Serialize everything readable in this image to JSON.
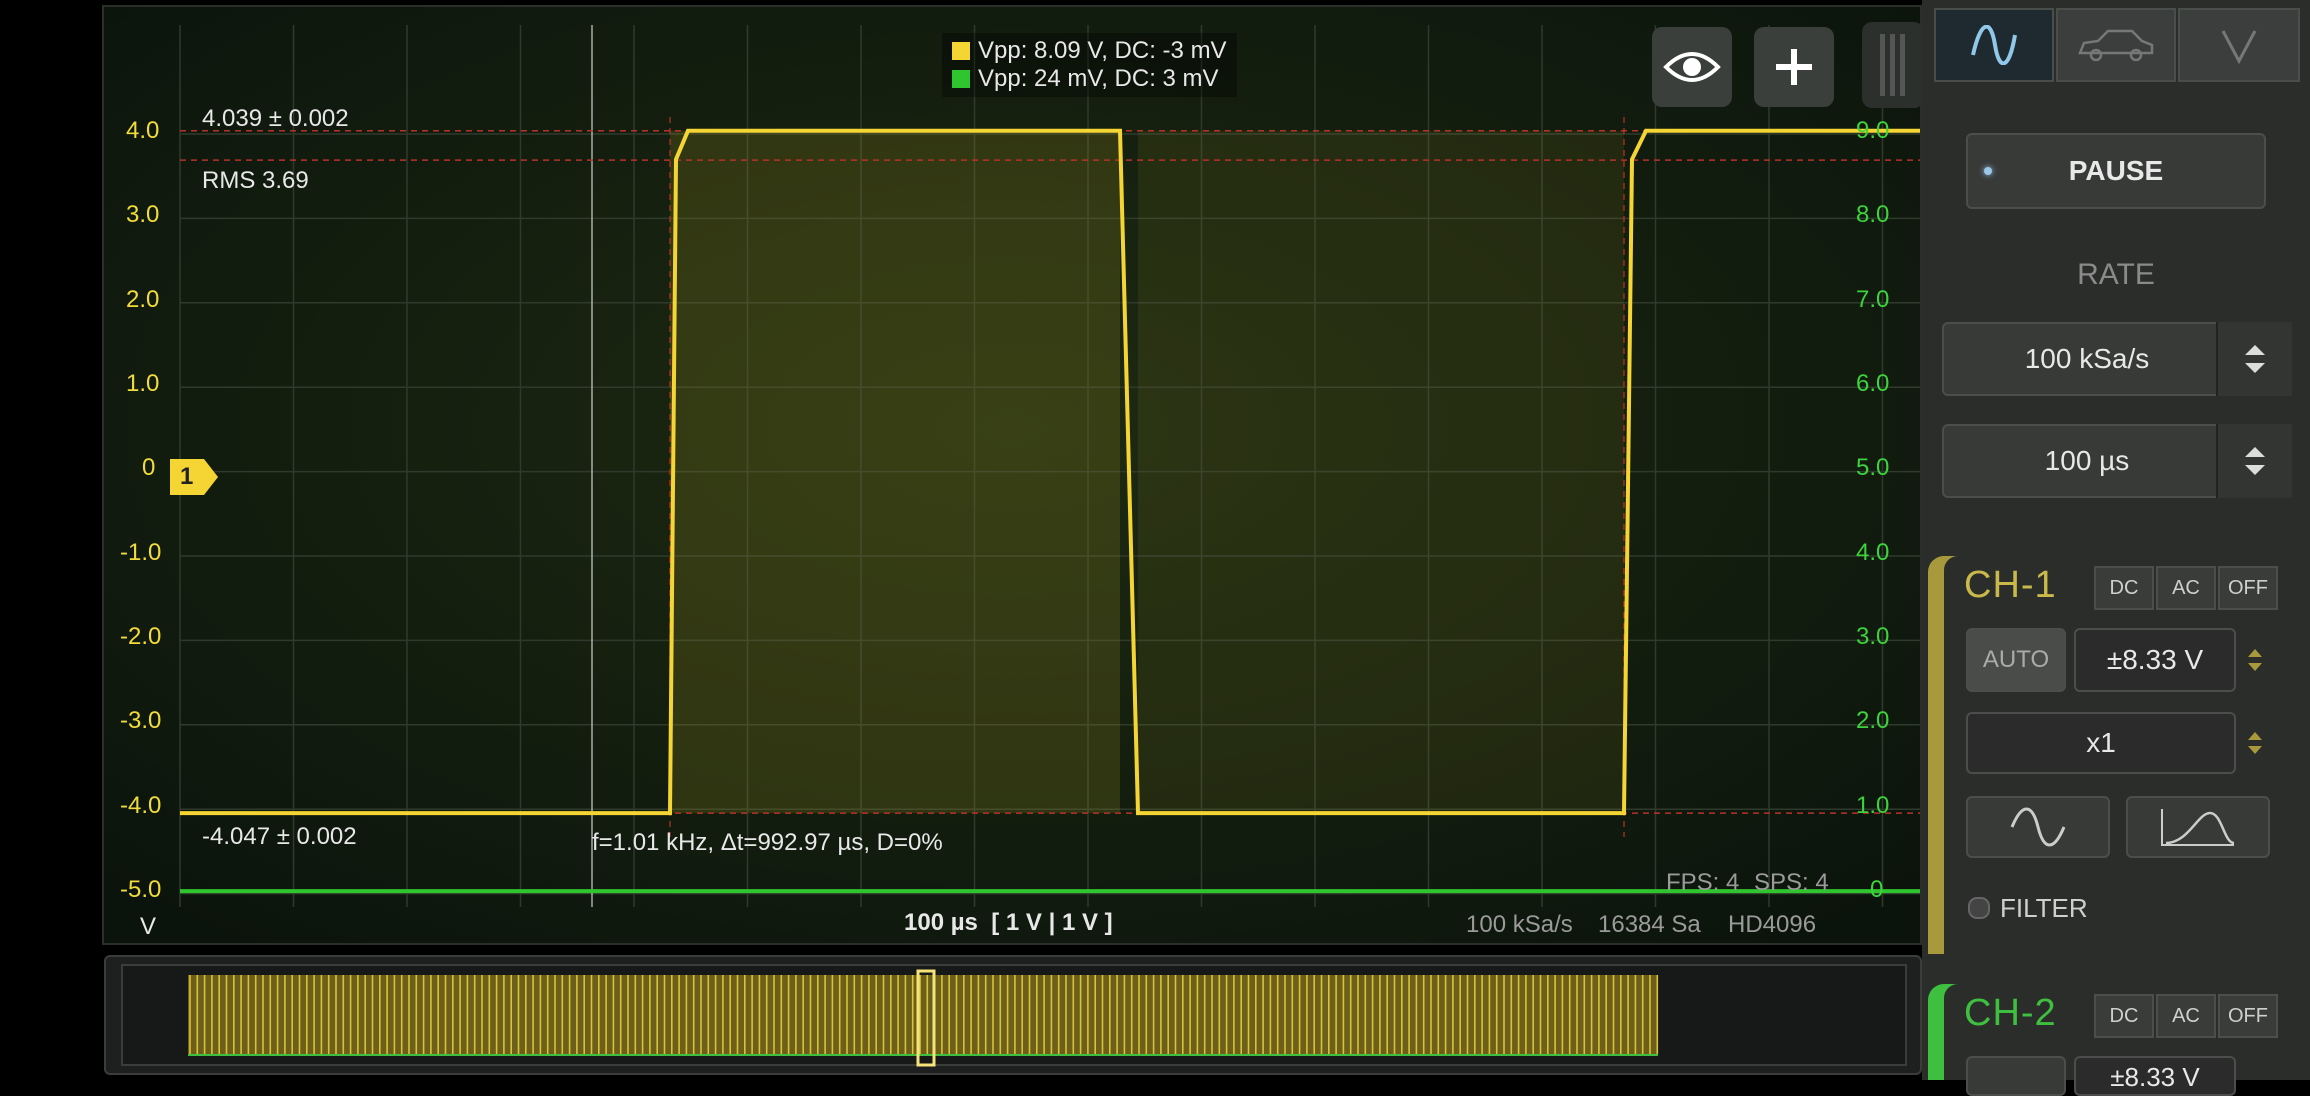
{
  "legend": {
    "ch1": {
      "text": "Vpp: 8.09 V, DC: -3 mV",
      "color": "#f5d533"
    },
    "ch2": {
      "text": "Vpp: 24 mV, DC: 3 mV",
      "color": "#2fc52f"
    }
  },
  "measurements": {
    "high": "4.039 ± 0.002",
    "rms": "RMS 3.69",
    "low": "-4.047 ± 0.002",
    "freq": "f=1.01 kHz, Δt=992.97 µs, D=0%"
  },
  "left_axis": {
    "ticks": [
      "4.0",
      "3.0",
      "2.0",
      "1.0",
      "0",
      "-1.0",
      "-2.0",
      "-3.0",
      "-4.0",
      "-5.0"
    ],
    "unit": "V",
    "marker": "1"
  },
  "right_axis": {
    "ticks": [
      "9.0",
      "8.0",
      "7.0",
      "6.0",
      "5.0",
      "4.0",
      "3.0",
      "2.0",
      "1.0",
      "0"
    ]
  },
  "bottom": {
    "timebase": "100 µs  [ 1 V | 1 V ]",
    "rate": "100 kSa/s",
    "samples": "16384 Sa",
    "hd": "HD4096",
    "fps": "FPS: 4",
    "sps": "SPS: 4"
  },
  "icons": {
    "eye": "eye-icon",
    "plus": "plus-icon",
    "wave": "sine-wave-icon",
    "car": "car-icon",
    "volt": "volt-v-icon"
  },
  "controls": {
    "pause": "PAUSE",
    "rate_label": "RATE",
    "sample_rate": "100 kSa/s",
    "time_div": "100 µs"
  },
  "ch1": {
    "title": "CH-1",
    "coupling": [
      "DC",
      "AC",
      "OFF"
    ],
    "auto": "AUTO",
    "range": "±8.33 V",
    "probe": "x1",
    "filter": "FILTER",
    "color": "#c9b94a"
  },
  "ch2": {
    "title": "CH-2",
    "coupling": [
      "DC",
      "AC",
      "OFF"
    ],
    "range": "±8.33 V",
    "color": "#3fbf3f"
  },
  "chart_data": {
    "type": "line",
    "title": "",
    "xlabel": "",
    "ylabel": "V",
    "ylim": [
      -5.0,
      4.0
    ],
    "y2lim": [
      0,
      9.0
    ],
    "grid": true,
    "series": [
      {
        "name": "CH-1",
        "x": [
          0,
          490,
          496,
          508,
          940,
          958,
          1444,
          1452,
          1466,
          1840
        ],
        "values": [
          -4.047,
          -4.047,
          3.7,
          4.039,
          4.039,
          -4.047,
          -4.047,
          3.7,
          4.039,
          4.039
        ]
      },
      {
        "name": "CH-2",
        "x": [
          0,
          1840
        ],
        "values": [
          -4.97,
          -4.97
        ]
      }
    ]
  }
}
